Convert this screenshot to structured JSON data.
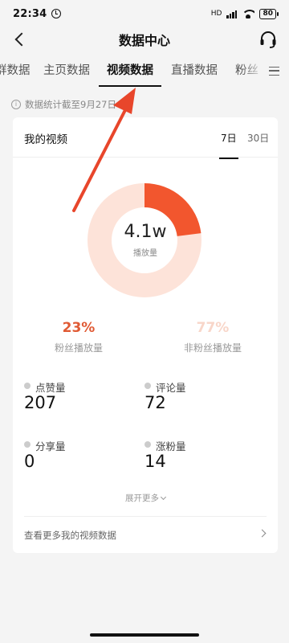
{
  "status_bar": {
    "time": "22:34",
    "network": "HD",
    "battery": "80"
  },
  "nav": {
    "title": "数据中心",
    "back_icon": "back-arrow-icon",
    "service_icon": "headset-icon"
  },
  "tabs": [
    {
      "label": "群数据",
      "active": false
    },
    {
      "label": "主页数据",
      "active": false
    },
    {
      "label": "视频数据",
      "active": true
    },
    {
      "label": "直播数据",
      "active": false
    },
    {
      "label": "粉丝",
      "active": false
    }
  ],
  "notice": "数据统计截至9月27日",
  "card": {
    "title": "我的视频",
    "ranges": [
      {
        "label": "7日",
        "active": true
      },
      {
        "label": "30日",
        "active": false
      }
    ],
    "donut": {
      "value": "4.1w",
      "label": "播放量",
      "fan_fraction": 0.23,
      "colors": {
        "fan": "#f2562e",
        "non_fan": "#fde3d9"
      }
    },
    "split": {
      "fan": {
        "pct": "23%",
        "label": "粉丝播放量",
        "color": "#e05a34"
      },
      "non_fan": {
        "pct": "77%",
        "label": "非粉丝播放量",
        "color": "#f8d6c9"
      }
    },
    "metrics": [
      {
        "label": "点赞量",
        "value": "207"
      },
      {
        "label": "评论量",
        "value": "72"
      },
      {
        "label": "分享量",
        "value": "0"
      },
      {
        "label": "涨粉量",
        "value": "14"
      }
    ],
    "expand_label": "展开更多",
    "more_link": "查看更多我的视频数据"
  }
}
